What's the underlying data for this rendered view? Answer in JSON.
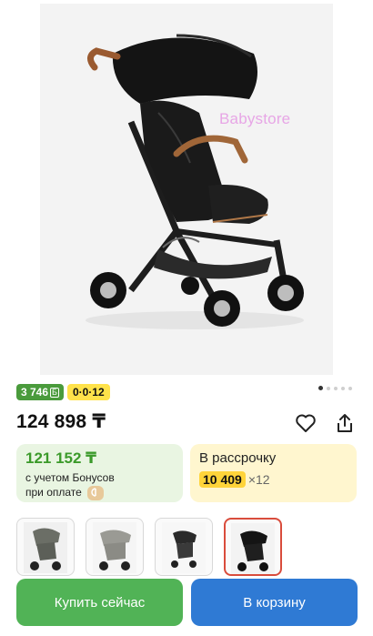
{
  "product_image": {
    "watermark": "Babystore",
    "carousel": {
      "total": 5,
      "active": 1
    }
  },
  "badges": {
    "bonus": "3 746",
    "bonus_icon": "Б",
    "installment": "0·0·12"
  },
  "price": "124 898 ₸",
  "actions": {
    "favorite_icon": "heart-icon",
    "share_icon": "share-icon"
  },
  "bonus_card": {
    "amount": "121 152 ₸",
    "line1": "с учетом Бонусов",
    "line2": "при оплате",
    "badge_icon": "kaspi-icon"
  },
  "installment_card": {
    "title": "В рассрочку",
    "monthly": "10 409",
    "months": "×12"
  },
  "thumbnails": [
    {
      "selected": false
    },
    {
      "selected": false
    },
    {
      "selected": false
    },
    {
      "selected": true
    }
  ],
  "buttons": {
    "buy_now": "Купить сейчас",
    "add_to_cart": "В корзину"
  },
  "colors": {
    "green": "#51b356",
    "blue": "#2f7ad4",
    "yellow": "#ffd43a",
    "bonus_green": "#4a9b3c"
  }
}
